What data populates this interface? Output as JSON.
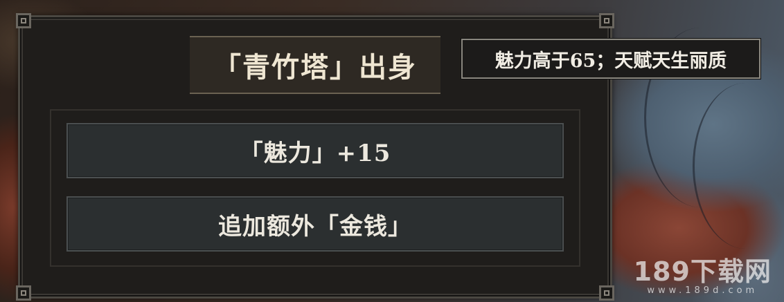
{
  "event": {
    "title": "「青竹塔」出身",
    "options": [
      {
        "label": "「魅力」+15"
      },
      {
        "label": "追加额外「金钱」"
      }
    ]
  },
  "tooltip": {
    "text": "魅力高于65；天赋天生丽质"
  },
  "watermark": {
    "main": "189下载网",
    "sub": "www.189d.com"
  },
  "colors": {
    "panel_bg": "#1f1d1b",
    "title_plate": "#2e2923",
    "option_bg": "#2b2f30",
    "text": "#efe6d2"
  }
}
